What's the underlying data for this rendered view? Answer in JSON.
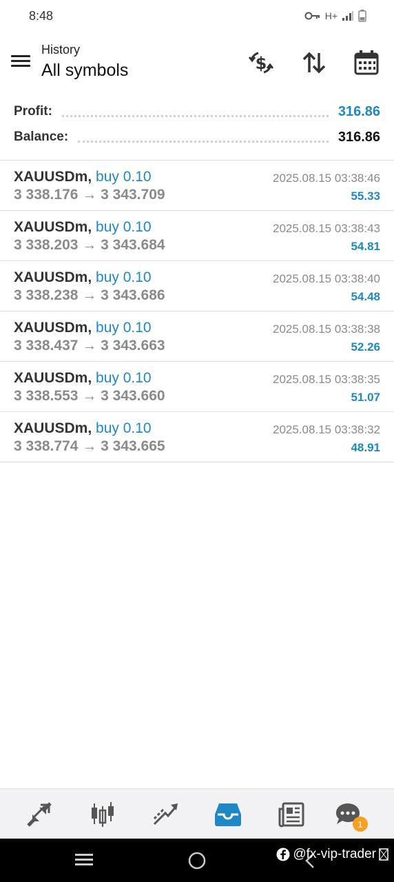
{
  "status": {
    "time": "8:48",
    "network": "H+"
  },
  "header": {
    "subtitle": "History",
    "title": "All symbols"
  },
  "summary": {
    "profit_label": "Profit:",
    "profit_value": "316.86",
    "balance_label": "Balance:",
    "balance_value": "316.86"
  },
  "colors": {
    "accent": "#1e88c7",
    "badge": "#f5a020"
  },
  "trades": [
    {
      "symbol": "XAUUSDm,",
      "side": "buy 0.10",
      "open": "3 338.176",
      "arrow": "→",
      "close": "3 343.709",
      "time": "2025.08.15 03:38:46",
      "profit": "55.33"
    },
    {
      "symbol": "XAUUSDm,",
      "side": "buy 0.10",
      "open": "3 338.203",
      "arrow": "→",
      "close": "3 343.684",
      "time": "2025.08.15 03:38:43",
      "profit": "54.81"
    },
    {
      "symbol": "XAUUSDm,",
      "side": "buy 0.10",
      "open": "3 338.238",
      "arrow": "→",
      "close": "3 343.686",
      "time": "2025.08.15 03:38:40",
      "profit": "54.48"
    },
    {
      "symbol": "XAUUSDm,",
      "side": "buy 0.10",
      "open": "3 338.437",
      "arrow": "→",
      "close": "3 343.663",
      "time": "2025.08.15 03:38:38",
      "profit": "52.26"
    },
    {
      "symbol": "XAUUSDm,",
      "side": "buy 0.10",
      "open": "3 338.553",
      "arrow": "→",
      "close": "3 343.660",
      "time": "2025.08.15 03:38:35",
      "profit": "51.07"
    },
    {
      "symbol": "XAUUSDm,",
      "side": "buy 0.10",
      "open": "3 338.774",
      "arrow": "→",
      "close": "3 343.665",
      "time": "2025.08.15 03:38:32",
      "profit": "48.91"
    }
  ],
  "bottom_nav": {
    "items": [
      "quotes-icon",
      "chart-icon",
      "trade-icon",
      "history-icon",
      "news-icon",
      "messages-icon"
    ],
    "active": "history-icon",
    "messages_badge": "1"
  },
  "watermark": {
    "text": "@fx-vip-trader"
  }
}
